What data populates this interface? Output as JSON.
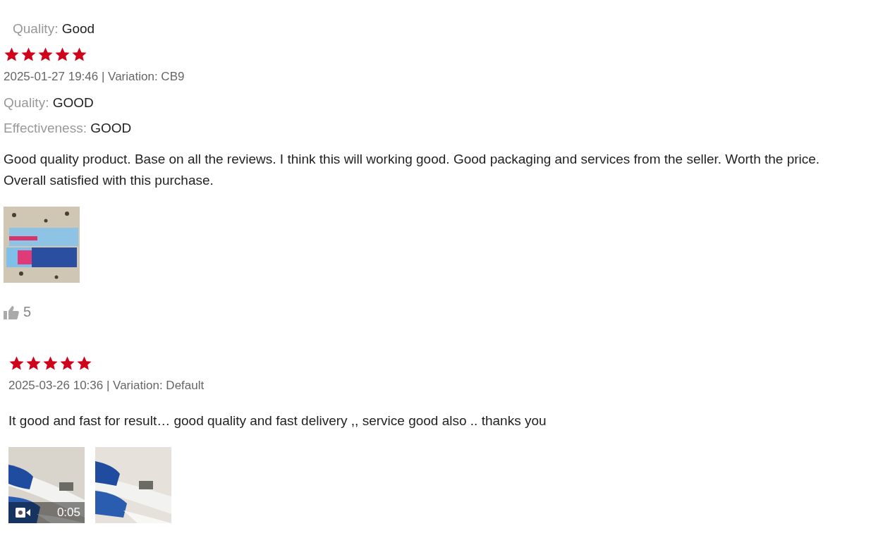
{
  "reviews": [
    {
      "attributes": [
        {
          "label": "Quality:",
          "value": "Good"
        }
      ]
    },
    {
      "stars": 5,
      "meta": "2025-01-27 19:46 | Variation: CB9",
      "attributes": [
        {
          "label": "Quality:",
          "value": "GOOD"
        },
        {
          "label": "Effectiveness:",
          "value": "GOOD"
        }
      ],
      "text": "Good quality product. Base on all the reviews. I think this will working good. Good packaging and services from the seller. Worth the price. Overall satisfied with this purchase.",
      "media": [
        {
          "kind": "picture"
        }
      ],
      "likes": "5"
    },
    {
      "stars": 5,
      "meta": "2025-03-26 10:36 | Variation: Default",
      "text": "It good and fast for result… good quality and fast delivery ,, service good also .. thanks you",
      "media": [
        {
          "kind": "video",
          "duration": "0:05"
        },
        {
          "kind": "picture"
        }
      ]
    }
  ]
}
